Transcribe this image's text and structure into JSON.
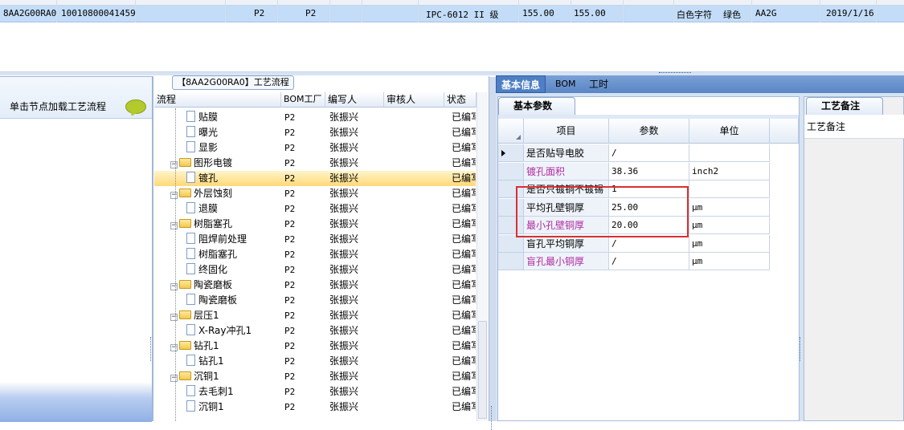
{
  "top_row": {
    "code": "8AA2G00RA0",
    "number": "10010800041459",
    "p1": "P2",
    "p2": "P2",
    "model": "IPC-6012 II 级",
    "v1": "155.00",
    "v2": "155.00",
    "char_color": "白色字符",
    "mask_color": "绿色",
    "short_code": "AA2G",
    "date": "2019/1/16"
  },
  "left_panel": {
    "hint": "单击节点加载工艺流程",
    "hint_icon": "speech-bubble-icon"
  },
  "flow_panel": {
    "title": "【8AA2G00RA0】工艺流程",
    "columns": [
      "流程",
      "BOM工厂",
      "编写人",
      "审核人",
      "状态"
    ],
    "rows": [
      {
        "label": "贴膜",
        "type": "doc",
        "level": 2,
        "bom": "P2",
        "author": "张振兴",
        "status": "已编写"
      },
      {
        "label": "曝光",
        "type": "doc",
        "level": 2,
        "bom": "P2",
        "author": "张振兴",
        "status": "已编写"
      },
      {
        "label": "显影",
        "type": "doc",
        "level": 2,
        "bom": "P2",
        "author": "张振兴",
        "status": "已编写"
      },
      {
        "label": "图形电镀",
        "type": "folder",
        "level": 1,
        "bom": "P2",
        "author": "张振兴",
        "status": "已编写"
      },
      {
        "label": "镀孔",
        "type": "doc",
        "level": 2,
        "bom": "P2",
        "author": "张振兴",
        "status": "已编写",
        "selected": true
      },
      {
        "label": "外层蚀刻",
        "type": "folder",
        "level": 1,
        "bom": "P2",
        "author": "张振兴",
        "status": "已编写"
      },
      {
        "label": "退膜",
        "type": "doc",
        "level": 2,
        "bom": "P2",
        "author": "张振兴",
        "status": "已编写"
      },
      {
        "label": "树脂塞孔",
        "type": "folder",
        "level": 1,
        "bom": "P2",
        "author": "张振兴",
        "status": "已编写"
      },
      {
        "label": "阻焊前处理",
        "type": "doc",
        "level": 2,
        "bom": "P2",
        "author": "张振兴",
        "status": "已编写"
      },
      {
        "label": "树脂塞孔",
        "type": "doc",
        "level": 2,
        "bom": "P2",
        "author": "张振兴",
        "status": "已编写"
      },
      {
        "label": "终固化",
        "type": "doc",
        "level": 2,
        "bom": "P2",
        "author": "张振兴",
        "status": "已编写"
      },
      {
        "label": "陶瓷磨板",
        "type": "folder",
        "level": 1,
        "bom": "P2",
        "author": "张振兴",
        "status": "已编写"
      },
      {
        "label": "陶瓷磨板",
        "type": "doc",
        "level": 2,
        "bom": "P2",
        "author": "张振兴",
        "status": "已编写"
      },
      {
        "label": "层压1",
        "type": "folder",
        "level": 1,
        "bom": "P2",
        "author": "张振兴",
        "status": "已编写"
      },
      {
        "label": "X-Ray冲孔1",
        "type": "doc",
        "level": 2,
        "bom": "P2",
        "author": "张振兴",
        "status": "已编写"
      },
      {
        "label": "钻孔1",
        "type": "folder",
        "level": 1,
        "bom": "P2",
        "author": "张振兴",
        "status": "已编写"
      },
      {
        "label": "钻孔1",
        "type": "doc",
        "level": 2,
        "bom": "P2",
        "author": "张振兴",
        "status": "已编写"
      },
      {
        "label": "沉铜1",
        "type": "folder",
        "level": 1,
        "bom": "P2",
        "author": "张振兴",
        "status": "已编写"
      },
      {
        "label": "去毛刺1",
        "type": "doc",
        "level": 2,
        "bom": "P2",
        "author": "张振兴",
        "status": "已编写"
      },
      {
        "label": "沉铜1",
        "type": "doc",
        "level": 2,
        "bom": "P2",
        "author": "张振兴",
        "status": "已编写"
      }
    ]
  },
  "right_tabs": [
    "基本信息",
    "BOM",
    "工时"
  ],
  "params_panel": {
    "title": "基本参数",
    "columns": [
      "项目",
      "参数",
      "单位"
    ],
    "rows": [
      {
        "name": "是否贴导电胶",
        "value": "/",
        "unit": "",
        "magenta": false,
        "current": true
      },
      {
        "name": "镀孔面积",
        "value": "38.36",
        "unit": "inch2",
        "magenta": true
      },
      {
        "name": "是否只镀铜不镀锡",
        "value": "1",
        "unit": "",
        "magenta": false
      },
      {
        "name": "平均孔壁铜厚",
        "value": "25.00",
        "unit": "μm",
        "magenta": false
      },
      {
        "name": "最小孔壁铜厚",
        "value": "20.00",
        "unit": "μm",
        "magenta": true
      },
      {
        "name": "盲孔平均铜厚",
        "value": "/",
        "unit": "μm",
        "magenta": false
      },
      {
        "name": "盲孔最小铜厚",
        "value": "/",
        "unit": "μm",
        "magenta": true
      }
    ]
  },
  "notes_panel": {
    "tab": "工艺备注",
    "header": "工艺备注"
  },
  "colors": {
    "selected_row": "#c3dcf7",
    "tab_bar": "#5a86c4",
    "highlight": "#d9302f",
    "magenta_text": "#b02aa0"
  }
}
